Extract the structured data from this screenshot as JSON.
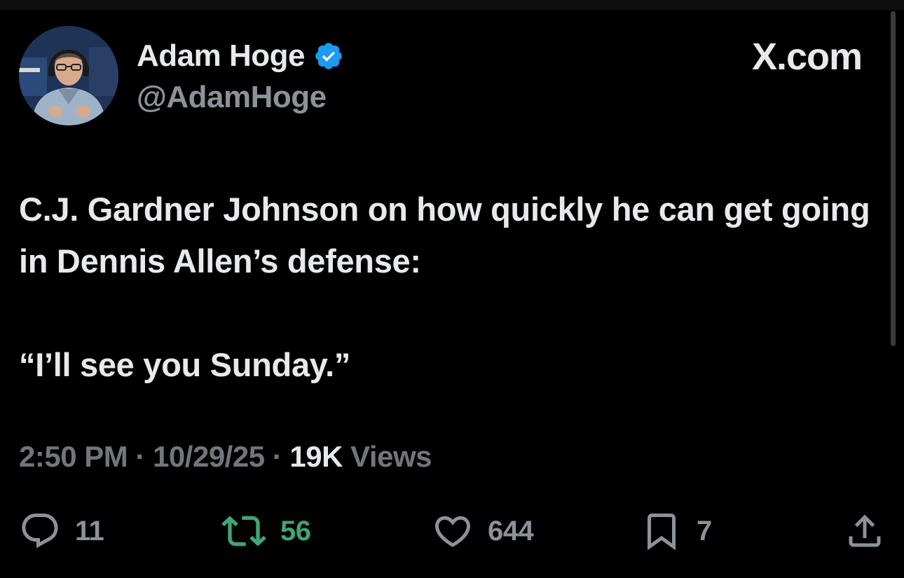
{
  "author": {
    "display_name": "Adam Hoge",
    "handle": "@AdamHoge",
    "verified": true,
    "avatar_icon": "profile-photo",
    "verified_icon": "verified-badge-icon",
    "verified_color": "#1d9bf0"
  },
  "brand": {
    "label": "X.com"
  },
  "tweet": {
    "line1": "C.J. Gardner Johnson on how quickly he can get going in Dennis Allen’s defense:",
    "line2": "“I’ll see you Sunday.”"
  },
  "meta": {
    "time": "2:50 PM",
    "separator": "·",
    "date": "10/29/25",
    "views_count": "19K",
    "views_label": "Views"
  },
  "actions": {
    "reply": {
      "icon": "reply-icon",
      "count": "11"
    },
    "retweet": {
      "icon": "retweet-icon",
      "count": "56",
      "color": "#3fa676"
    },
    "like": {
      "icon": "heart-icon",
      "count": "644"
    },
    "bookmark": {
      "icon": "bookmark-icon",
      "count": "7"
    },
    "share": {
      "icon": "share-icon"
    }
  },
  "colors": {
    "background": "#000000",
    "primary_text": "#e7e9ea",
    "secondary_text": "#71767b"
  }
}
